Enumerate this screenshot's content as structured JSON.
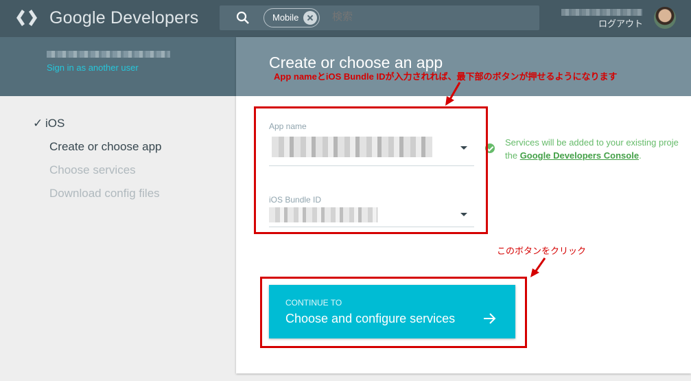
{
  "header": {
    "brand": "Google Developers",
    "search": {
      "chip_label": "Mobile",
      "placeholder": "検索"
    },
    "logout_label": "ログアウト"
  },
  "account": {
    "signin_label": "Sign in as another user"
  },
  "steps": {
    "ios": "iOS",
    "create": "Create or choose app",
    "services": "Choose services",
    "download": "Download config files"
  },
  "card": {
    "title": "Create or choose an app",
    "app_name_label": "App name",
    "bundle_id_label": "iOS Bundle ID",
    "notice_prefix": "Services will be added to your existing proje",
    "notice_line2_prefix": "the ",
    "notice_link": "Google Developers Console",
    "notice_suffix": ".",
    "continue_sub": "CONTINUE TO",
    "continue_main": "Choose and configure services"
  },
  "annotations": {
    "fields_note": "App nameとiOS Bundle IDが入力されれば、最下部のボタンが押せるようになります",
    "button_note": "このボタンをクリック"
  },
  "colors": {
    "topbar": "#455a64",
    "band": "#546e7a",
    "card_header": "#78909c",
    "accent": "#00bcd4",
    "annotation": "#d50000",
    "notice_green": "#66bb6a"
  }
}
